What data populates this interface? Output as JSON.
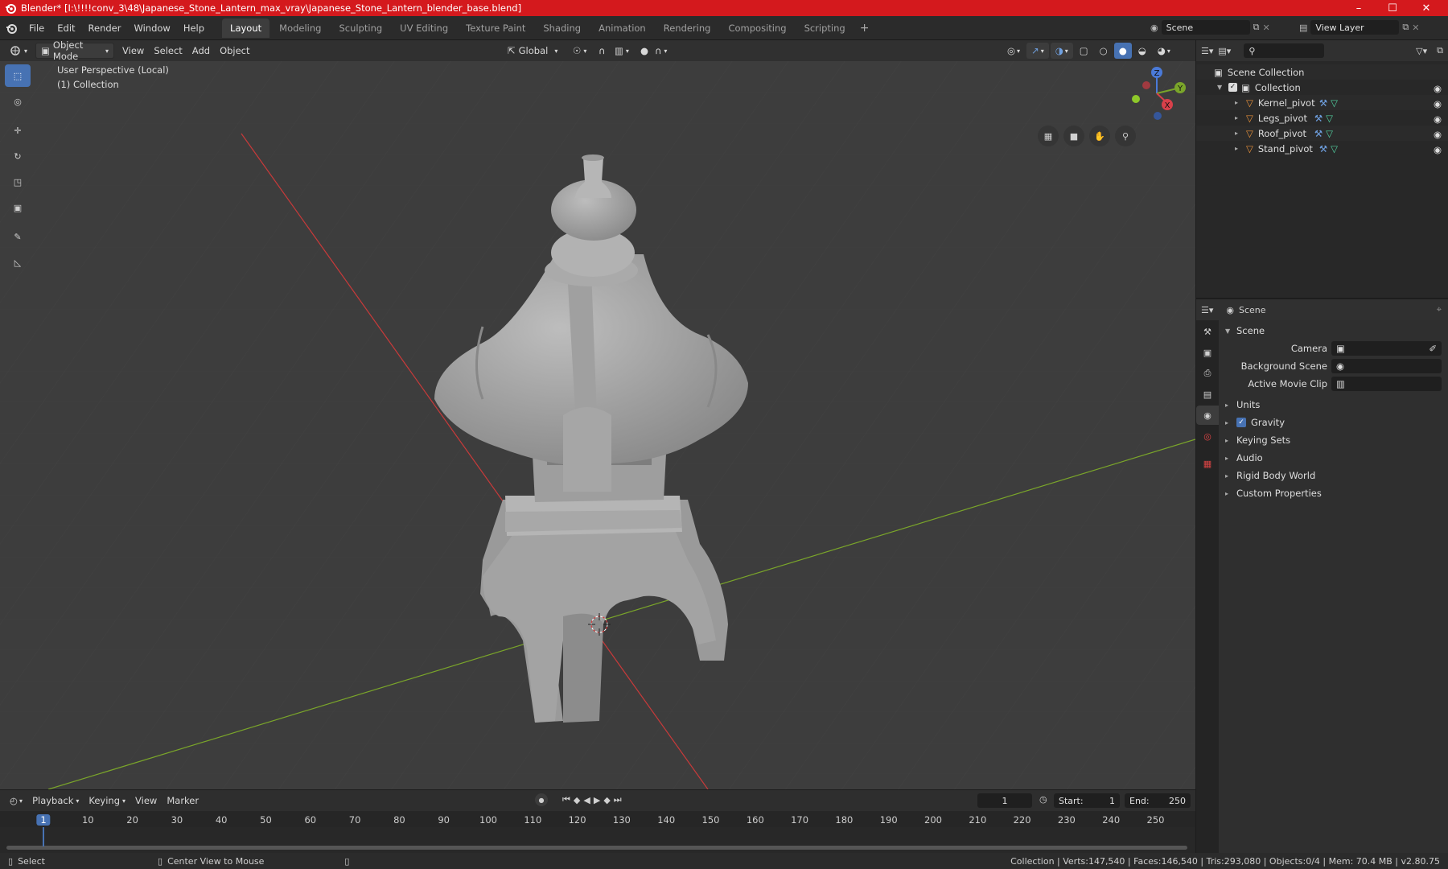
{
  "window": {
    "title": "Blender* [I:\\!!!!conv_3\\48\\Japanese_Stone_Lantern_max_vray\\Japanese_Stone_Lantern_blender_base.blend]"
  },
  "menu": [
    "File",
    "Edit",
    "Render",
    "Window",
    "Help"
  ],
  "workspaces": [
    "Layout",
    "Modeling",
    "Sculpting",
    "UV Editing",
    "Texture Paint",
    "Shading",
    "Animation",
    "Rendering",
    "Compositing",
    "Scripting"
  ],
  "active_workspace": "Layout",
  "scene_field": "Scene",
  "view_layer_field": "View Layer",
  "viewport_header": {
    "mode": "Object Mode",
    "view": "View",
    "select": "Select",
    "add": "Add",
    "object": "Object",
    "orientation": "Global"
  },
  "viewport": {
    "perspective": "User Perspective (Local)",
    "collection": "(1) Collection"
  },
  "gizmo": {
    "x": "X",
    "y": "Y",
    "z": "Z"
  },
  "outliner": {
    "root": "Scene Collection",
    "collection": "Collection",
    "items": [
      "Kernel_pivot",
      "Legs_pivot",
      "Roof_pivot",
      "Stand_pivot"
    ]
  },
  "properties": {
    "header": "Scene",
    "panel": "Scene",
    "camera_label": "Camera",
    "background_label": "Background Scene",
    "movieclip_label": "Active Movie Clip",
    "subpanels": [
      "Units",
      "Gravity",
      "Keying Sets",
      "Audio",
      "Rigid Body World",
      "Custom Properties"
    ],
    "gravity_checked": true
  },
  "timeline": {
    "playback": "Playback",
    "keying": "Keying",
    "view": "View",
    "marker": "Marker",
    "current_frame": "1",
    "start_label": "Start:",
    "start": "1",
    "end_label": "End:",
    "end": "250",
    "ruler": [
      "1",
      "10",
      "20",
      "30",
      "40",
      "50",
      "60",
      "70",
      "80",
      "90",
      "100",
      "110",
      "120",
      "130",
      "140",
      "150",
      "160",
      "170",
      "180",
      "190",
      "200",
      "210",
      "220",
      "230",
      "240",
      "250"
    ]
  },
  "status": {
    "select": "Select",
    "center": "Center View to Mouse",
    "stats": "Collection | Verts:147,540 | Faces:146,540 | Tris:293,080 | Objects:0/4 | Mem: 70.4 MB | v2.80.75"
  },
  "colors": {
    "title_bar": "#d4191d",
    "accent": "#4772b3",
    "x_axis": "#c83a3a",
    "y_axis": "#7aa52a",
    "object_icon": "#e8913a"
  }
}
